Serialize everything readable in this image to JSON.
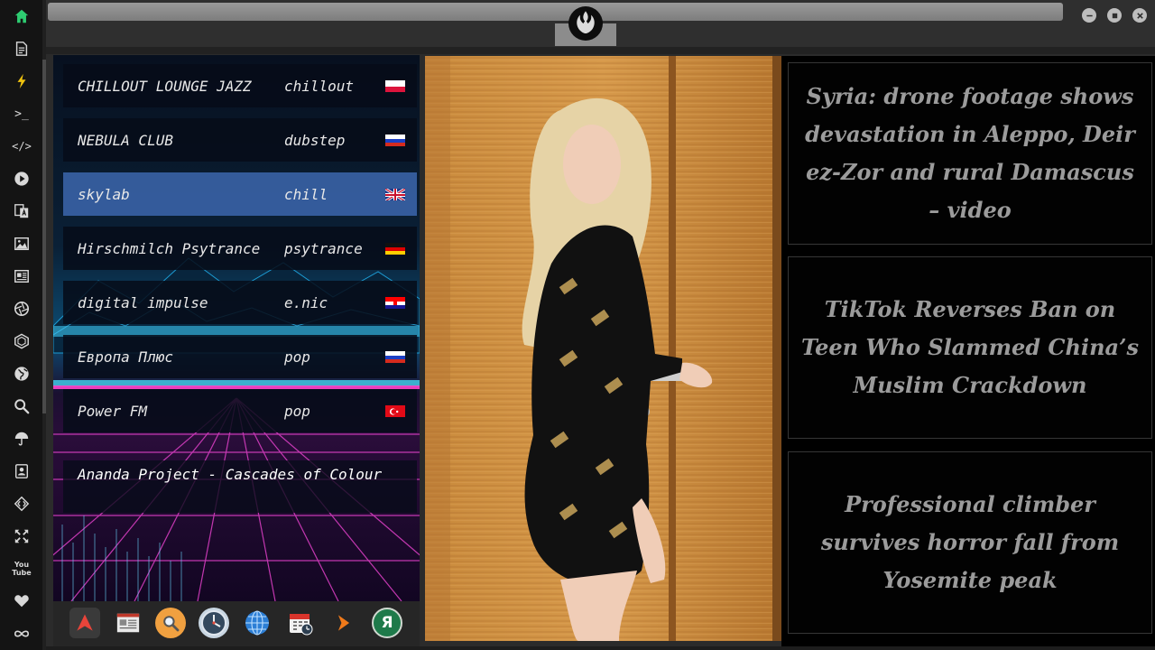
{
  "sidebar": {
    "icons": [
      "home-icon",
      "document-icon",
      "lightning-icon",
      "terminal-icon",
      "code-icon",
      "play-icon",
      "translate-icon",
      "image-icon",
      "news-icon",
      "aperture-icon",
      "hexagon-icon",
      "globe-icon",
      "search-icon",
      "umbrella-icon",
      "contacts-icon",
      "code-tags-icon",
      "expand-icon",
      "youtube-icon",
      "heart-icon",
      "infinity-icon"
    ],
    "terminal_glyph": ">_",
    "code_glyph": "</>",
    "youtube_label": "You Tube",
    "accent": "#2ecc71"
  },
  "radio": {
    "stations": [
      {
        "name": "CHILLOUT LOUNGE JAZZ",
        "genre": "chillout",
        "flag": "poland"
      },
      {
        "name": "NEBULA CLUB",
        "genre": "dubstep",
        "flag": "russia"
      },
      {
        "name": "skylab",
        "genre": "chill",
        "flag": "uk",
        "active": true
      },
      {
        "name": "Hirschmilch Psytrance",
        "genre": "psytrance",
        "flag": "germany"
      },
      {
        "name": "digital impulse",
        "genre": "e.nic",
        "flag": "croatia"
      },
      {
        "name": "Европа Плюс",
        "genre": "pop",
        "flag": "russia"
      },
      {
        "name": "Power FM",
        "genre": "pop",
        "flag": "turkey"
      }
    ],
    "now_playing": "Ananda Project - Cascades of Colour"
  },
  "dock": {
    "items": [
      "arch-linux-icon",
      "news-reader-icon",
      "search-app-icon",
      "clock-icon",
      "globe-browser-icon",
      "calendar-icon",
      "arrow-launcher-icon",
      "yandex-icon"
    ],
    "yandex_glyph": "Я"
  },
  "news": [
    {
      "headline": "Syria: drone footage shows devastation in Aleppo, Deir ez-Zor and rural Damascus – video"
    },
    {
      "headline": "TikTok Reverses Ban on Teen Who Slammed China’s Muslim Crackdown"
    },
    {
      "headline": "Professional climber survives horror fall from Yosemite peak"
    }
  ],
  "photo": {
    "alt": "woman in black patterned dress by wooden door"
  }
}
